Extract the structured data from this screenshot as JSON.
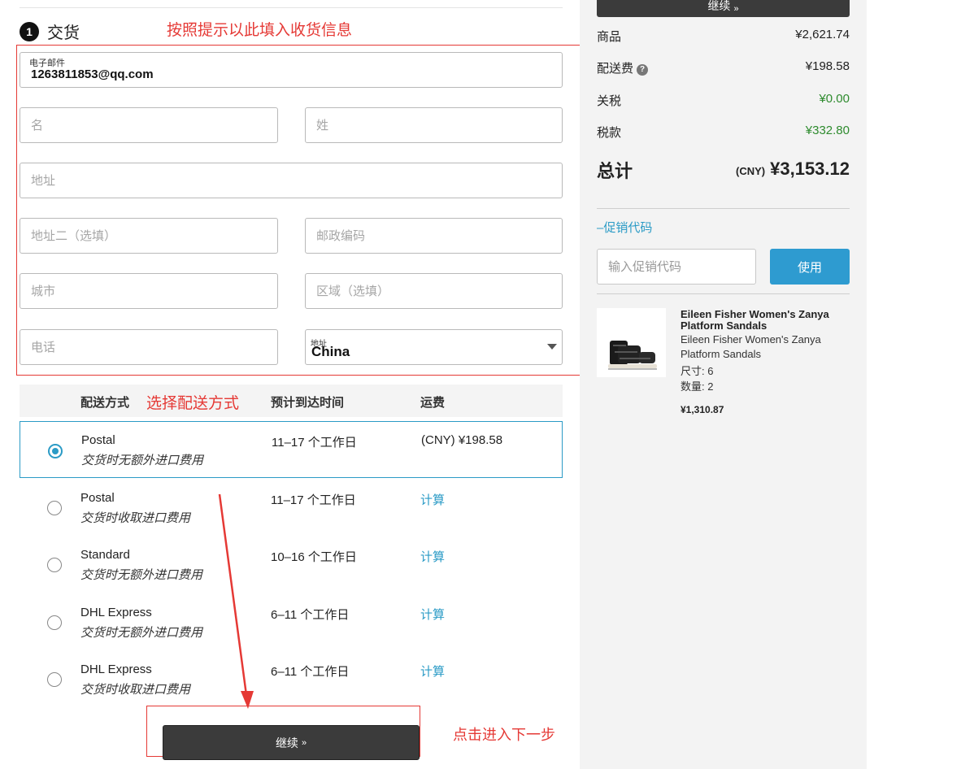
{
  "step": {
    "number": "1",
    "title": "交货"
  },
  "annotations": {
    "fill_info": "按照提示以此填入收货信息",
    "choose_shipping": "选择配送方式",
    "click_next": "点击进入下一步"
  },
  "form": {
    "email_label": "电子邮件",
    "email_value": "1263811853@qq.com",
    "first_name_placeholder": "名",
    "last_name_placeholder": "姓",
    "address_placeholder": "地址",
    "address2_placeholder": "地址二（选填）",
    "postcode_placeholder": "邮政编码",
    "city_placeholder": "城市",
    "region_placeholder": "区域（选填）",
    "phone_placeholder": "电话",
    "country_label": "地址",
    "country_value": "China"
  },
  "shipping": {
    "headers": {
      "method": "配送方式",
      "eta": "预计到达时间",
      "fee": "运费"
    },
    "options": [
      {
        "name": "Postal",
        "desc": "交货时无额外进口费用",
        "eta": "11–17 个工作日",
        "fee": "(CNY) ¥198.58",
        "selected": true
      },
      {
        "name": "Postal",
        "desc": "交货时收取进口费用",
        "eta": "11–17 个工作日",
        "fee": "计算",
        "selected": false
      },
      {
        "name": "Standard",
        "desc": "交货时无额外进口费用",
        "eta": "10–16 个工作日",
        "fee": "计算",
        "selected": false
      },
      {
        "name": "DHL Express",
        "desc": "交货时无额外进口费用",
        "eta": "6–11 个工作日",
        "fee": "计算",
        "selected": false
      },
      {
        "name": "DHL Express",
        "desc": "交货时收取进口费用",
        "eta": "6–11 个工作日",
        "fee": "计算",
        "selected": false
      }
    ]
  },
  "continue_label": "继续",
  "continue_icon": "double-chevron-right-icon",
  "summary": {
    "top_button_label": "继续",
    "items_label": "商品",
    "items_value": "¥2,621.74",
    "shipping_label": "配送费",
    "shipping_value": "¥198.58",
    "duty_label": "关税",
    "duty_value": "¥0.00",
    "tax_label": "税款",
    "tax_value": "¥332.80",
    "total_label": "总计",
    "total_currency": "(CNY)",
    "total_value": "¥3,153.12",
    "green_color": "#2e8b2e"
  },
  "promo": {
    "toggle_label": "–促销代码",
    "input_placeholder": "输入促销代码",
    "apply_label": "使用",
    "accent": "#2e9bd0"
  },
  "product": {
    "title": "Eileen Fisher Women's Zanya Platform Sandals",
    "subtitle": "Eileen Fisher Women's Zanya Platform Sandals",
    "size": "尺寸: 6",
    "quantity": "数量: 2",
    "price": "¥1,310.87"
  }
}
